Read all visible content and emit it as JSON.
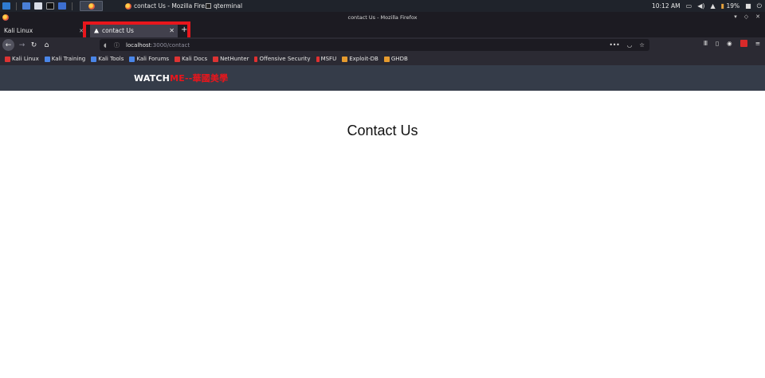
{
  "taskbar": {
    "task_firefox_label": "contact Us - Mozilla Fire...",
    "task_terminal_label": "qterminal",
    "clock": "10:12 AM",
    "battery": "19%"
  },
  "window": {
    "title": "contact Us - Mozilla Firefox"
  },
  "tabs": [
    {
      "label": "Kali Linux",
      "active": false
    },
    {
      "label": "contact Us",
      "active": true
    }
  ],
  "url": {
    "host": "localhost",
    "path": ":3000/contact"
  },
  "bookmarks": [
    {
      "label": "Kali Linux",
      "icon": "kali-icon"
    },
    {
      "label": "Kali Training",
      "icon": "kali-training-icon"
    },
    {
      "label": "Kali Tools",
      "icon": "kali-tools-icon"
    },
    {
      "label": "Kali Forums",
      "icon": "kali-forums-icon"
    },
    {
      "label": "Kali Docs",
      "icon": "kali-docs-icon"
    },
    {
      "label": "NetHunter",
      "icon": "nethunter-icon"
    },
    {
      "label": "Offensive Security",
      "icon": "offsec-icon"
    },
    {
      "label": "MSFU",
      "icon": "msfu-icon"
    },
    {
      "label": "Exploit-DB",
      "icon": "exploitdb-icon"
    },
    {
      "label": "GHDB",
      "icon": "ghdb-icon"
    }
  ],
  "site": {
    "logo_part1": "WATCH",
    "logo_part2": "ME--華國美學",
    "heading": "Contact Us"
  },
  "colors": {
    "highlight": "#e8161c",
    "site_header": "#353c49",
    "logo_accent": "#e8161c"
  }
}
